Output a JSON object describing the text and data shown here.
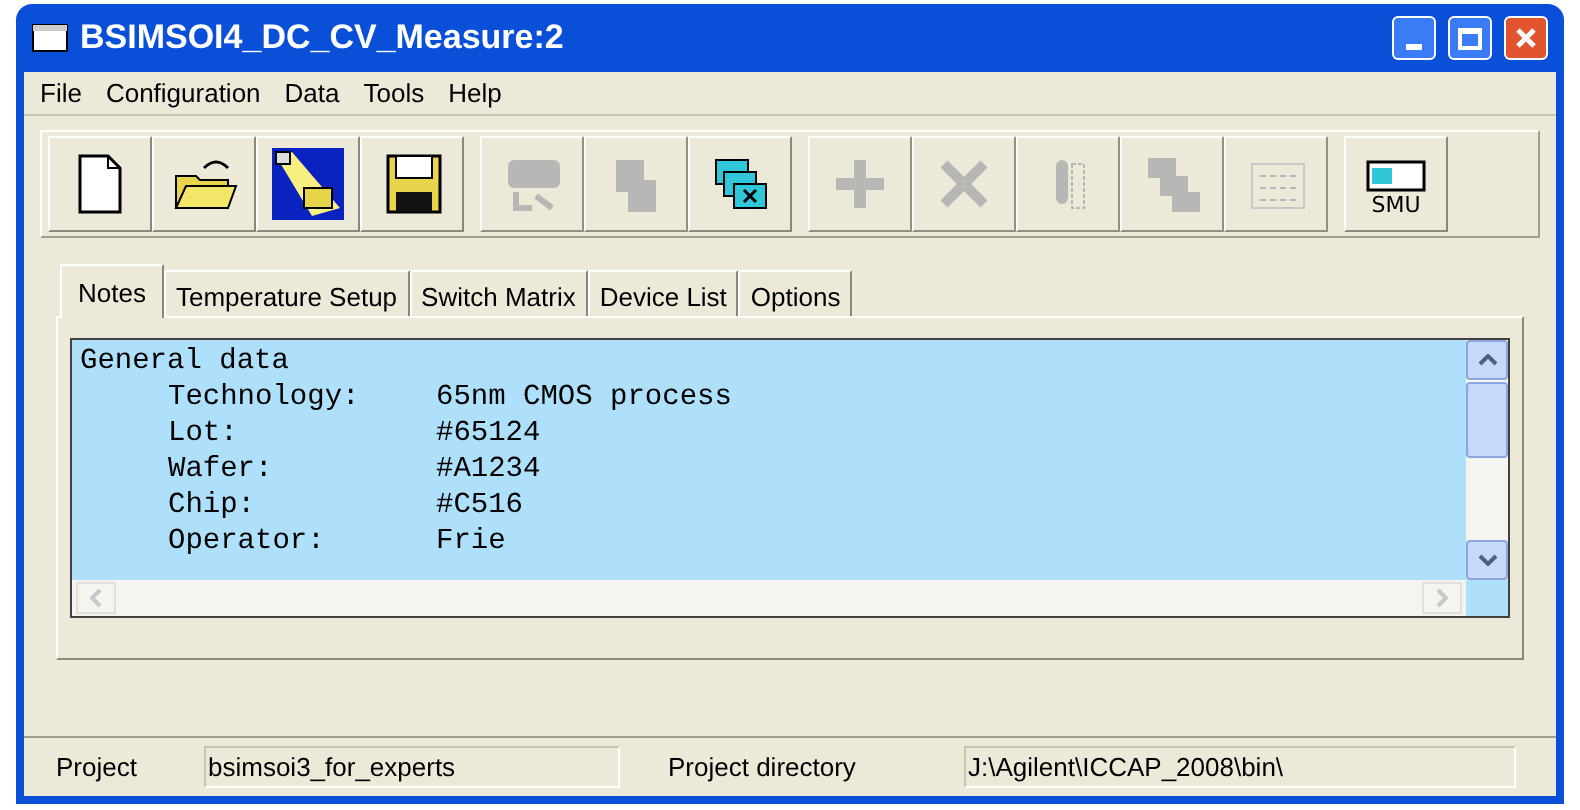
{
  "window": {
    "title": "BSIMSOI4_DC_CV_Measure:2"
  },
  "menu": [
    "File",
    "Configuration",
    "Data",
    "Tools",
    "Help"
  ],
  "toolbar": [
    {
      "buttons": [
        {
          "kind": "new",
          "disabled": false
        },
        {
          "kind": "open",
          "disabled": false
        },
        {
          "kind": "spotlight",
          "disabled": false
        },
        {
          "kind": "save",
          "disabled": false
        }
      ]
    },
    {
      "buttons": [
        {
          "kind": "import",
          "disabled": true
        },
        {
          "kind": "copy",
          "disabled": true
        },
        {
          "kind": "windows",
          "disabled": false
        }
      ]
    },
    {
      "buttons": [
        {
          "kind": "add",
          "disabled": true
        },
        {
          "kind": "delete",
          "disabled": true
        },
        {
          "kind": "thermometer",
          "disabled": true
        },
        {
          "kind": "tree",
          "disabled": true
        },
        {
          "kind": "matrix",
          "disabled": true
        }
      ]
    },
    {
      "buttons": [
        {
          "kind": "smu",
          "disabled": false,
          "label": "SMU"
        }
      ]
    }
  ],
  "tabs": [
    {
      "label": "Notes",
      "selected": true
    },
    {
      "label": "Temperature Setup",
      "selected": false
    },
    {
      "label": "Switch Matrix",
      "selected": false
    },
    {
      "label": "Device List",
      "selected": false
    },
    {
      "label": "Options",
      "selected": false
    }
  ],
  "notes": {
    "heading": "General data",
    "fields": [
      {
        "label": "Technology:",
        "value": "65nm CMOS process"
      },
      {
        "label": "Lot:",
        "value": "#65124"
      },
      {
        "label": "Wafer:",
        "value": "#A1234"
      },
      {
        "label": "Chip:",
        "value": "#C516"
      },
      {
        "label": "Operator:",
        "value": "Frie"
      }
    ]
  },
  "status_bar": [
    {
      "kind": "label",
      "text": "Project"
    },
    {
      "kind": "field",
      "text": "bsimsoi3_for_experts"
    },
    {
      "kind": "label",
      "text": "Project directory"
    },
    {
      "kind": "field",
      "text": "J:\\Agilent\\ICCAP_2008\\bin\\"
    }
  ]
}
